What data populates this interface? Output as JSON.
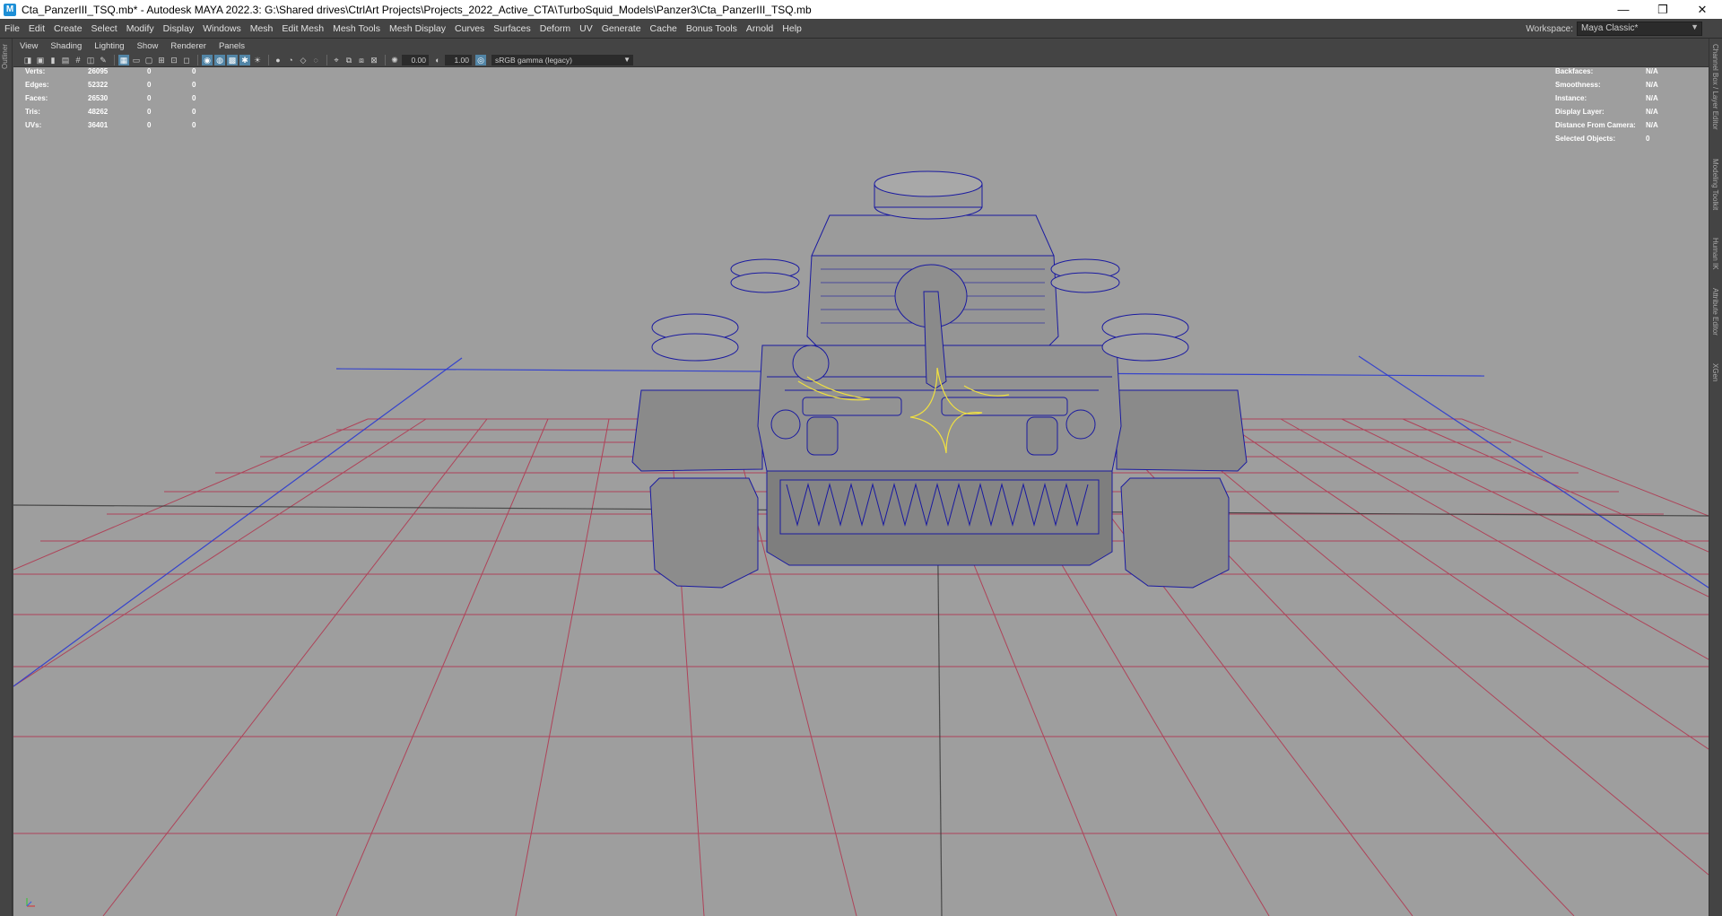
{
  "titlebar": {
    "icon": "M",
    "title": "Cta_PanzerIII_TSQ.mb* - Autodesk MAYA 2022.3: G:\\Shared drives\\CtrlArt Projects\\Projects_2022_Active_CTA\\TurboSquid_Models\\Panzer3\\Cta_PanzerIII_TSQ.mb",
    "minimize": "—",
    "restore": "❐",
    "close": "✕"
  },
  "menubar": {
    "items": [
      "File",
      "Edit",
      "Create",
      "Select",
      "Modify",
      "Display",
      "Windows",
      "Mesh",
      "Edit Mesh",
      "Mesh Tools",
      "Mesh Display",
      "Curves",
      "Surfaces",
      "Deform",
      "UV",
      "Generate",
      "Cache",
      "Bonus Tools",
      "Arnold",
      "Help"
    ],
    "workspace_label": "Workspace:",
    "workspace_value": "Maya Classic*"
  },
  "left_strip": {
    "label": "Outliner"
  },
  "right_strip": {
    "tabs": [
      "Channel Box / Layer Editor",
      "Modeling Toolkit",
      "Human IK",
      "Attribute Editor",
      "XGen"
    ]
  },
  "panel_menu": {
    "items": [
      "View",
      "Shading",
      "Lighting",
      "Show",
      "Renderer",
      "Panels"
    ]
  },
  "panel_toolbar": {
    "exposure": "0.00",
    "gamma": "1.00",
    "colorspace": "sRGB gamma (legacy)"
  },
  "hud_left": {
    "rows": [
      {
        "label": "Verts:",
        "v1": "26095",
        "v2": "0",
        "v3": "0"
      },
      {
        "label": "Edges:",
        "v1": "52322",
        "v2": "0",
        "v3": "0"
      },
      {
        "label": "Faces:",
        "v1": "26530",
        "v2": "0",
        "v3": "0"
      },
      {
        "label": "Tris:",
        "v1": "48262",
        "v2": "0",
        "v3": "0"
      },
      {
        "label": "UVs:",
        "v1": "36401",
        "v2": "0",
        "v3": "0"
      }
    ]
  },
  "hud_right": {
    "rows": [
      {
        "label": "Backfaces:",
        "value": "N/A"
      },
      {
        "label": "Smoothness:",
        "value": "N/A"
      },
      {
        "label": "Instance:",
        "value": "N/A"
      },
      {
        "label": "Display Layer:",
        "value": "N/A"
      },
      {
        "label": "Distance From Camera:",
        "value": "N/A"
      },
      {
        "label": "Selected Objects:",
        "value": "0"
      }
    ]
  },
  "colors": {
    "viewport_bg": "#9e9e9e",
    "grid_line": "#b03a52",
    "axis_blue": "#2a3ad0",
    "wireframe": "#1a1aa0",
    "selection_yellow": "#f0e040",
    "mesh_fill": "#8c8c8c"
  }
}
